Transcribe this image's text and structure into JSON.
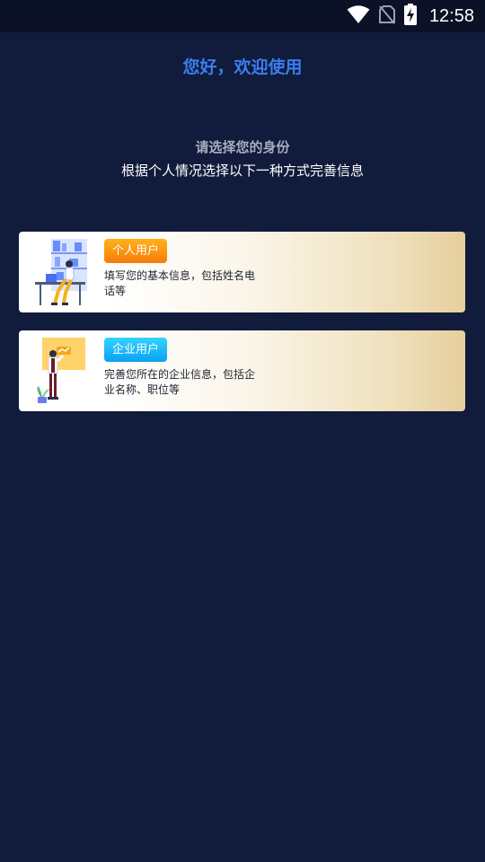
{
  "status_bar": {
    "time": "12:58",
    "icons": [
      "wifi-icon",
      "no-sim-icon",
      "battery-charging-icon"
    ]
  },
  "header": {
    "greeting": "您好，欢迎使用"
  },
  "prompt": {
    "title": "请选择您的身份",
    "subtitle": "根据个人情况选择以下一种方式完善信息"
  },
  "options": [
    {
      "tag": "个人用户",
      "description": "填写您的基本信息，包括姓名电话等",
      "tag_color": "#f7920e",
      "icon": "person-at-desk-illustration"
    },
    {
      "tag": "企业用户",
      "description": "完善您所在的企业信息，包括企业名称、职位等",
      "tag_color": "#14b4f7",
      "icon": "businessman-presentation-illustration"
    }
  ],
  "colors": {
    "background": "#111b3b",
    "greeting": "#3a7ef0",
    "card_gradient_end": "#e6cf9d"
  }
}
